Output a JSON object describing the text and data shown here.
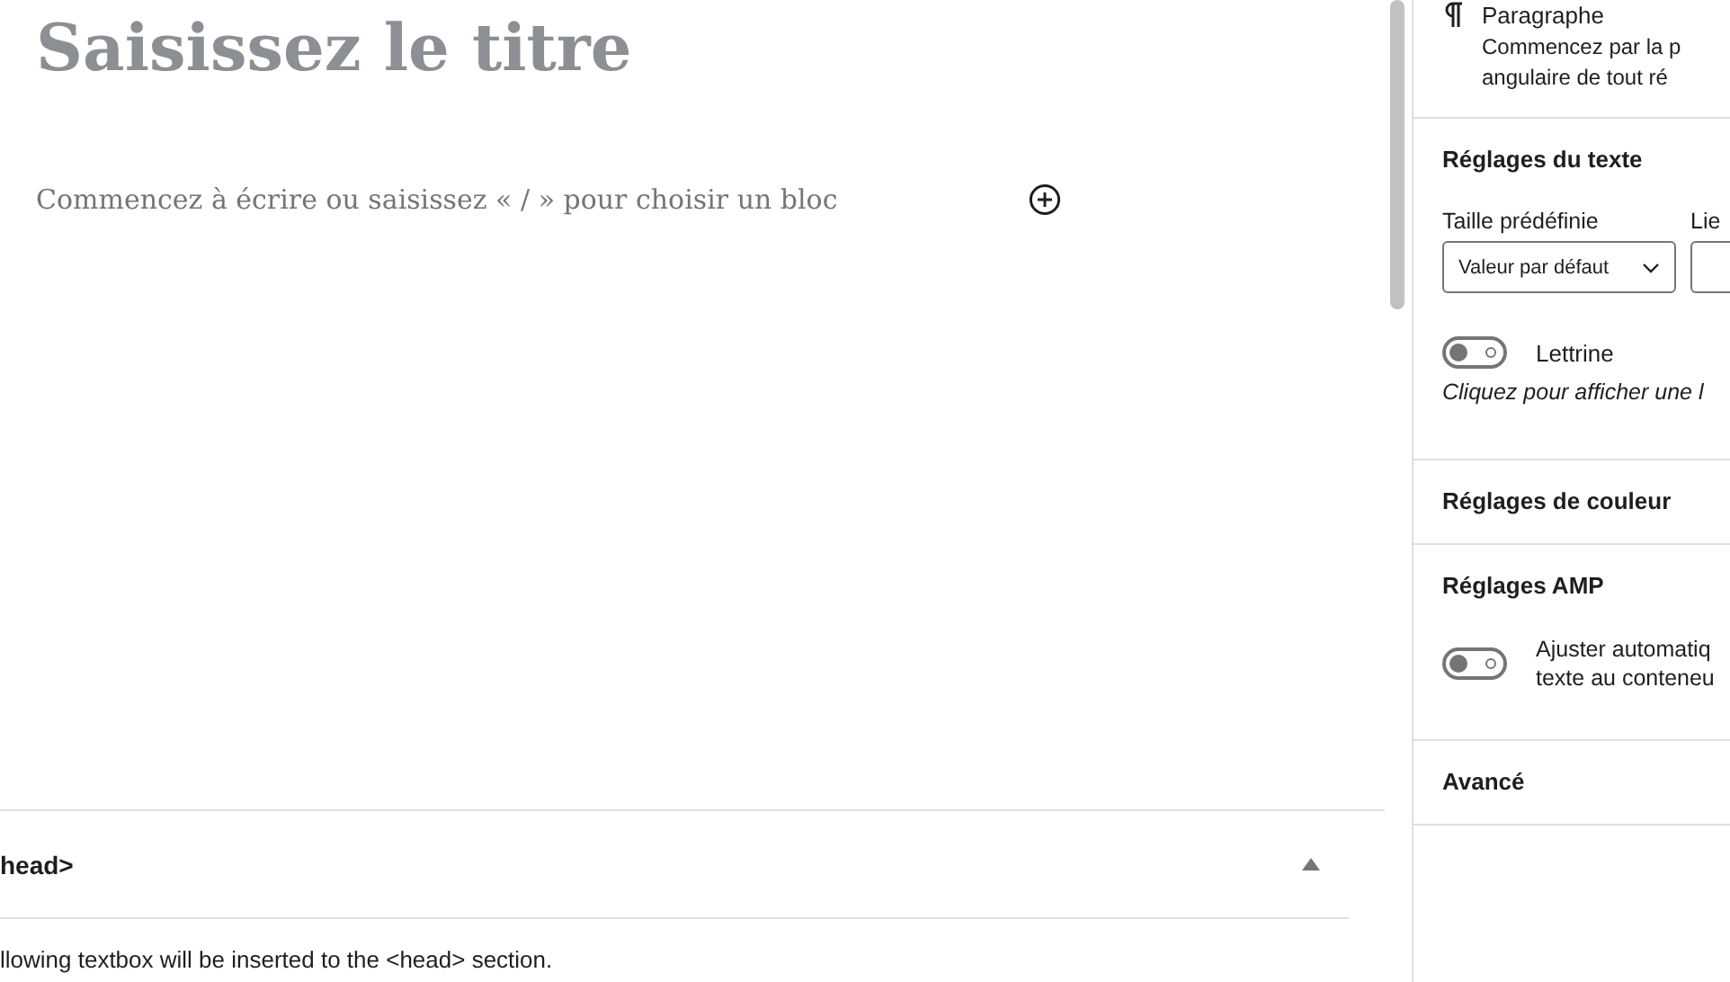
{
  "editor": {
    "title_placeholder": "Saisissez le titre",
    "block_placeholder": "Commencez à écrire ou saisissez « / » pour choisir un bloc"
  },
  "meta_box": {
    "title": "head>",
    "expanded": true,
    "description": "llowing textbox will be inserted to the <head> section."
  },
  "sidebar": {
    "block": {
      "name": "Paragraphe",
      "description": [
        "Commencez par la p",
        "angulaire de tout ré"
      ]
    },
    "text_settings": {
      "title": "Réglages du texte",
      "preset_label": "Taille prédéfinie",
      "preset_value": "Valeur par défaut",
      "custom_label": "Lie",
      "drop_cap": {
        "label": "Lettrine",
        "on": false,
        "help": "Cliquez pour afficher une l"
      }
    },
    "color_settings": {
      "title": "Réglages de couleur"
    },
    "amp_settings": {
      "title": "Réglages AMP",
      "fit_text": {
        "label": [
          "Ajuster automatiq",
          "texte au conteneu"
        ],
        "on": false
      }
    },
    "advanced": {
      "title": "Avancé"
    }
  }
}
